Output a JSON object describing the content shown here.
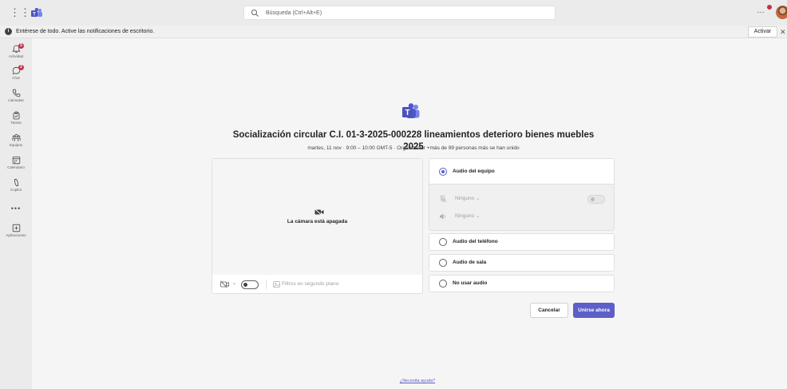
{
  "titlebar": {
    "search_placeholder": "Búsqueda (Ctrl+Alt+E)"
  },
  "banner": {
    "text": "Entérese de todo. Active las notificaciones de escritorio.",
    "button": "Activar",
    "close": "✕"
  },
  "rail": {
    "items": [
      {
        "label": "Actividad",
        "icon": "bell-icon",
        "badge": "5"
      },
      {
        "label": "Chat",
        "icon": "chat-icon",
        "badge": "2"
      },
      {
        "label": "Llamadas",
        "icon": "phone-icon"
      },
      {
        "label": "Tareas",
        "icon": "tasks-icon"
      },
      {
        "label": "Equipos",
        "icon": "teams-group-icon"
      },
      {
        "label": "Calendario",
        "icon": "calendar-icon"
      },
      {
        "label": "Copilot",
        "icon": "copilot-icon"
      },
      {
        "label": "Aplicaciones",
        "icon": "apps-add-icon"
      }
    ],
    "more": "•••"
  },
  "meeting": {
    "title": "Socialización circular C.I. 01-3-2025-000228 lineamientos deterioro bienes muebles 2025",
    "subtitle": "martes, 11 nov  ·  9:00  –  10:00 GMT-5  ·  Organizador +más de 99 personas más se han unido"
  },
  "video": {
    "camera_off": "La cámara está apagada",
    "filters": "Filtros en segundo plano",
    "camera_toggle": "off"
  },
  "audio": {
    "options": [
      {
        "label": "Audio del equipo",
        "selected": true
      },
      {
        "label": "Audio del teléfono",
        "selected": false
      },
      {
        "label": "Audio de sala",
        "selected": false
      },
      {
        "label": "No usar audio",
        "selected": false
      }
    ],
    "mic_device": "Ninguno ⌄",
    "speaker_device": "Ninguno ⌄"
  },
  "actions": {
    "cancel": "Cancelar",
    "join": "Unirse ahora"
  },
  "help_link": "¿Necesita ayuda?",
  "colors": {
    "accent": "#5b5fc7",
    "badge": "#c4314b"
  }
}
